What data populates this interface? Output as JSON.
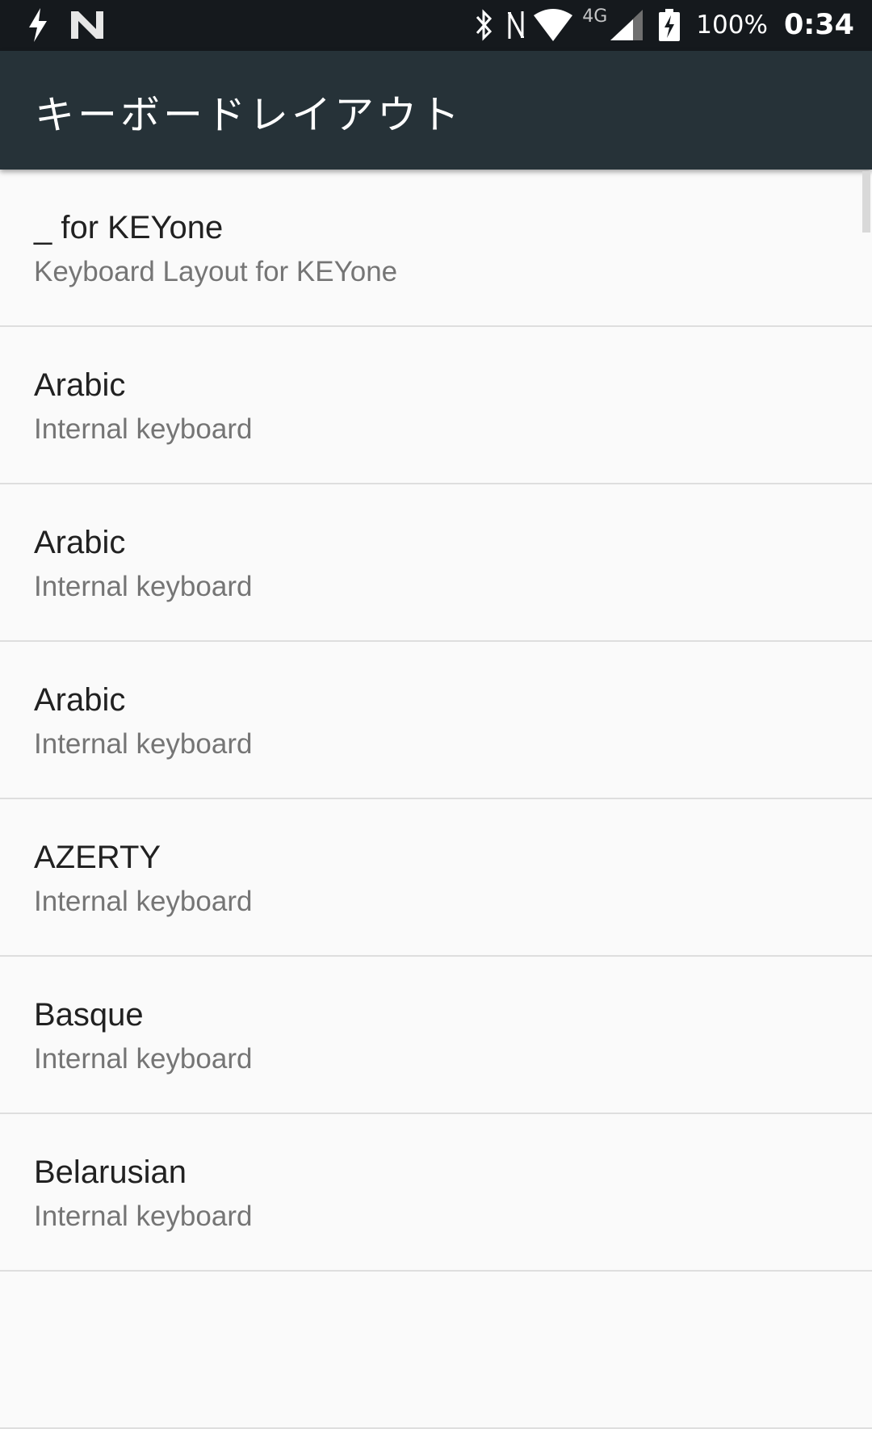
{
  "status_bar": {
    "left_icons": [
      "charging-bolt-icon",
      "n-notification-icon"
    ],
    "right_icons": [
      "bluetooth-icon",
      "nfc-icon",
      "wifi-icon",
      "signal-icon",
      "battery-charging-icon"
    ],
    "network_type": "4G",
    "battery_percent": "100%",
    "time": "0:34"
  },
  "app_bar": {
    "title": "キーボードレイアウト"
  },
  "layouts": [
    {
      "title": "_ for KEYone",
      "subtitle": "Keyboard Layout for KEYone"
    },
    {
      "title": "Arabic",
      "subtitle": "Internal keyboard"
    },
    {
      "title": "Arabic",
      "subtitle": "Internal keyboard"
    },
    {
      "title": "Arabic",
      "subtitle": "Internal keyboard"
    },
    {
      "title": "AZERTY",
      "subtitle": "Internal keyboard"
    },
    {
      "title": "Basque",
      "subtitle": "Internal keyboard"
    },
    {
      "title": "Belarusian",
      "subtitle": "Internal keyboard"
    },
    {
      "title": "",
      "subtitle": ""
    }
  ],
  "colors": {
    "status_bar": "#15191d",
    "app_bar": "#263238",
    "background": "#fafafa",
    "title_text": "#212121",
    "subtitle_text": "#757575"
  }
}
